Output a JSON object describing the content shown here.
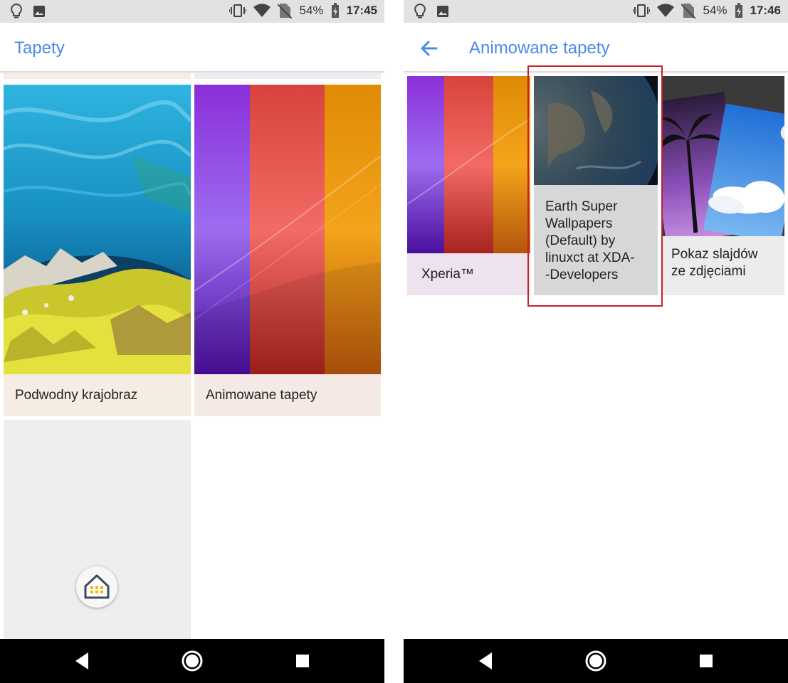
{
  "left": {
    "status": {
      "battery": "54%",
      "time": "17:45"
    },
    "appbar": {
      "title": "Tapety"
    },
    "tiles": [
      {
        "label": "Podwodny krajobraz"
      },
      {
        "label": "Animowane tapety"
      }
    ]
  },
  "right": {
    "status": {
      "battery": "54%",
      "time": "17:46"
    },
    "appbar": {
      "title": "Animowane tapety"
    },
    "tiles": [
      {
        "label": "Xperia™"
      },
      {
        "label_lines": [
          "Earth Super",
          "Wallpapers",
          "(Default) by",
          "linuxct at XDA-",
          "-Developers"
        ]
      },
      {
        "label_lines": [
          "Pokaz slajdów",
          "ze zdjęciami"
        ]
      }
    ]
  },
  "colors": {
    "accent": "#4a8ae8",
    "highlight": "#c8202a",
    "navbar": "#000000",
    "statusbar": "#e2e2e2"
  }
}
